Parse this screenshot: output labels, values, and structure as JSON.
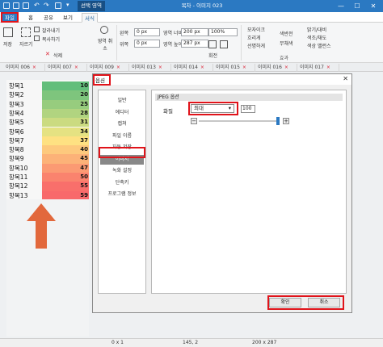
{
  "window": {
    "title": "목차 - 이미지 023",
    "context_tab": "선택 영역",
    "controls": [
      "—",
      "☐",
      "✕"
    ]
  },
  "ribbon": {
    "tabs": [
      "파일",
      "홈",
      "공유",
      "보기",
      "서식"
    ],
    "clipboard": {
      "paste": "저장",
      "crop": "자르기",
      "copy": "잘라내기",
      "copy2": "복사하기",
      "delete": "삭제",
      "cancel": "영역 취소"
    },
    "position": {
      "left_label": "왼쪽",
      "left_value": "0 px",
      "top_label": "위쪽",
      "top_value": "0 px"
    },
    "size": {
      "width_label": "영역 너비",
      "width_value": "200 px",
      "height_label": "영역 높이",
      "height_value": "287 px"
    },
    "zoom": {
      "value": "100%",
      "rotate_left": "",
      "rotate_right": "",
      "rotate": "회전"
    },
    "effects": {
      "mosaic": "모자이크",
      "blur": "흐리게",
      "sharpen": "선명하게",
      "invert": "색반전",
      "grayscale": "무채색",
      "group_label": "효과"
    },
    "adjust": {
      "brightness": "밝기/대비",
      "color": "색조/채도",
      "balance": "색상 밸런스"
    }
  },
  "doc_tabs": [
    "이미지 006",
    "이미지 007",
    "이미지 009",
    "이미지 013",
    "이미지 014",
    "이미지 015",
    "이미지 016",
    "이미지 017"
  ],
  "sheet": {
    "rows": [
      {
        "label": "항목1",
        "value": "10",
        "color": "#63be7b"
      },
      {
        "label": "항목2",
        "value": "20",
        "color": "#7ec57d"
      },
      {
        "label": "항목3",
        "value": "25",
        "color": "#97cc7e"
      },
      {
        "label": "항목4",
        "value": "28",
        "color": "#b1d480"
      },
      {
        "label": "항목5",
        "value": "31",
        "color": "#cbdb81"
      },
      {
        "label": "항목6",
        "value": "34",
        "color": "#e5e282"
      },
      {
        "label": "항목7",
        "value": "37",
        "color": "#fee182"
      },
      {
        "label": "항목8",
        "value": "40",
        "color": "#fdc97d"
      },
      {
        "label": "항목9",
        "value": "45",
        "color": "#fcb278"
      },
      {
        "label": "항목10",
        "value": "47",
        "color": "#fb9a73"
      },
      {
        "label": "항목11",
        "value": "50",
        "color": "#fa836e"
      },
      {
        "label": "항목12",
        "value": "55",
        "color": "#f96f6b"
      },
      {
        "label": "항목13",
        "value": "59",
        "color": "#f8696b"
      }
    ]
  },
  "arrow_color": "#e2683c",
  "dialog": {
    "title": "옵션",
    "close": "✕",
    "nav": [
      "일반",
      "에디터",
      "캡쳐",
      "파일 이름",
      "자동 저장",
      "이미지",
      "녹화 설정",
      "단축키",
      "프로그램 정보"
    ],
    "selected_nav": "이미지",
    "group_title": "JPEG 옵션",
    "quality_label": "화질",
    "quality_value": "최대",
    "quality_number": "100",
    "slider_minus": "−",
    "slider_plus": "+",
    "ok": "확인",
    "cancel": "취소"
  },
  "status": {
    "selection": "0 x 1",
    "cursor": "145, 2",
    "size": "200 x 287"
  },
  "highlight_color": "#e0131a",
  "accent_color": "#2b79c2"
}
